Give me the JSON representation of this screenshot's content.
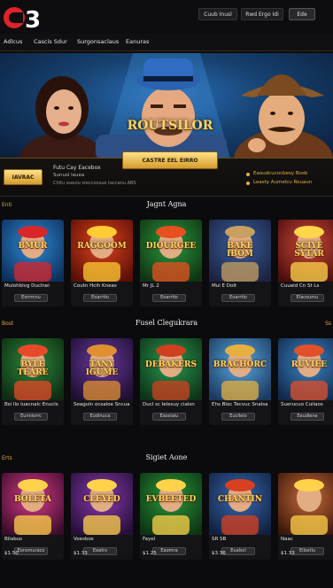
{
  "header": {
    "buttons": [
      "Cuub Inusl",
      "Rwd Ergo Idi",
      "Ede"
    ]
  },
  "nav": {
    "items": [
      "Adlcus",
      "Cascis Sdur",
      "Surgonsaclaus",
      "Eanuras"
    ]
  },
  "hero": {
    "title": "ROUTSILOR"
  },
  "promo": {
    "main_button": "CASTRE EEL EIRRO",
    "left_button": "IAVRAC",
    "text1": "Futu Cay Eacebox",
    "text2": "Sunusl lauea",
    "text3": "Chitu sseulu sreccoosue taccanu ABS",
    "right1": "Eaoudcucocbesy Bosb",
    "right2": "Leasty Aumelcu Rouaun"
  },
  "sections": [
    {
      "title": "Jagnt Agna",
      "side_left": "Enti",
      "side_right": "",
      "tiles": [
        {
          "art_title": "BMUR",
          "name": "Mulohblvg Duclnei",
          "button": "Eorrrnnu",
          "colors": [
            "#2f8bd6",
            "#0d2f5a"
          ],
          "accent": "#d8262b"
        },
        {
          "art_title": "RAGGOOM",
          "name": "Coutn Hcih Kneas",
          "button": "Eoarrtio",
          "colors": [
            "#e0431c",
            "#5a0f06"
          ],
          "accent": "#ffcc33"
        },
        {
          "art_title": "DIOURGEE",
          "name": "Mr JL 2",
          "button": "Eoarrtio",
          "colors": [
            "#2b9a3b",
            "#0f3314"
          ],
          "accent": "#e85020"
        },
        {
          "art_title": "BAKE IBOM",
          "name": "Mui E Dolt",
          "button": "Eoarrtio",
          "colors": [
            "#3a5fa0",
            "#1b2340"
          ],
          "accent": "#c8a060"
        },
        {
          "art_title": "SCIYE SYTAR",
          "name": "Cuuaid Cn St Ls",
          "button": "Elacoumu",
          "colors": [
            "#d04a3a",
            "#4a0d0d"
          ],
          "accent": "#ffd54a"
        }
      ]
    },
    {
      "title": "Fusel Clegukrara",
      "side_left": "Bost",
      "side_right": "Ss",
      "tiles": [
        {
          "art_title": "BYLE TEARE",
          "name": "Bsi llo Iuacnalc Enucls",
          "button": "Eunniorrc",
          "colors": [
            "#2c8a3a",
            "#0e2a12"
          ],
          "accent": "#e64a2a"
        },
        {
          "art_title": "TANY IGUME",
          "name": "Seaguln ocsaloe Sncua",
          "button": "Eudlnuca",
          "colors": [
            "#6a3aa0",
            "#1e0f30"
          ],
          "accent": "#e09030"
        },
        {
          "art_title": "DEBAKERS",
          "name": "Ducl sc Ielesuy cialsn",
          "button": "Eaoslaiu",
          "colors": [
            "#2a9a50",
            "#0d3318"
          ],
          "accent": "#d04020"
        },
        {
          "art_title": "BRACHORC",
          "name": "Ehs Bloc Tecvuc Snalsa",
          "button": "Eucllelo",
          "colors": [
            "#5aa8e0",
            "#1a3a60"
          ],
          "accent": "#e6b040"
        },
        {
          "art_title": "RUVIEE",
          "name": "Suerucuo Cuilaos",
          "button": "Eeudlene",
          "colors": [
            "#3a86c8",
            "#12284a"
          ],
          "accent": "#e0502a"
        }
      ]
    },
    {
      "title": "Sigiet Aone",
      "side_left": "Erts",
      "side_right": "",
      "tiles": [
        {
          "art_title": "BOLETA",
          "name": "Bilabus",
          "button": "Eonsmuraco",
          "colors": [
            "#d93a8a",
            "#3a0d2a"
          ],
          "accent": "#ffd24a"
        },
        {
          "art_title": "CLEYED",
          "name": "Voesbos",
          "button": "Eeatrs",
          "colors": [
            "#8a3ab0",
            "#260f38"
          ],
          "accent": "#ffd24a"
        },
        {
          "art_title": "EVBEETED",
          "name": "Fayel",
          "button": "Eaomra",
          "colors": [
            "#2a9a3a",
            "#0d3314"
          ],
          "accent": "#ffd24a"
        },
        {
          "art_title": "CHANTIN",
          "name": "SR SB",
          "button": "Eualscl",
          "colors": [
            "#3a6ab0",
            "#102040"
          ],
          "accent": "#d84020"
        },
        {
          "art_title": "",
          "name": "Naac",
          "button": "Eilostiu",
          "colors": [
            "#c86a3a",
            "#3a180a"
          ],
          "accent": "#ffd24a"
        }
      ]
    }
  ],
  "section_prices": [
    [
      "$1.50",
      "$1.33",
      "$1.25",
      "$3.36",
      "$1.33"
    ]
  ]
}
